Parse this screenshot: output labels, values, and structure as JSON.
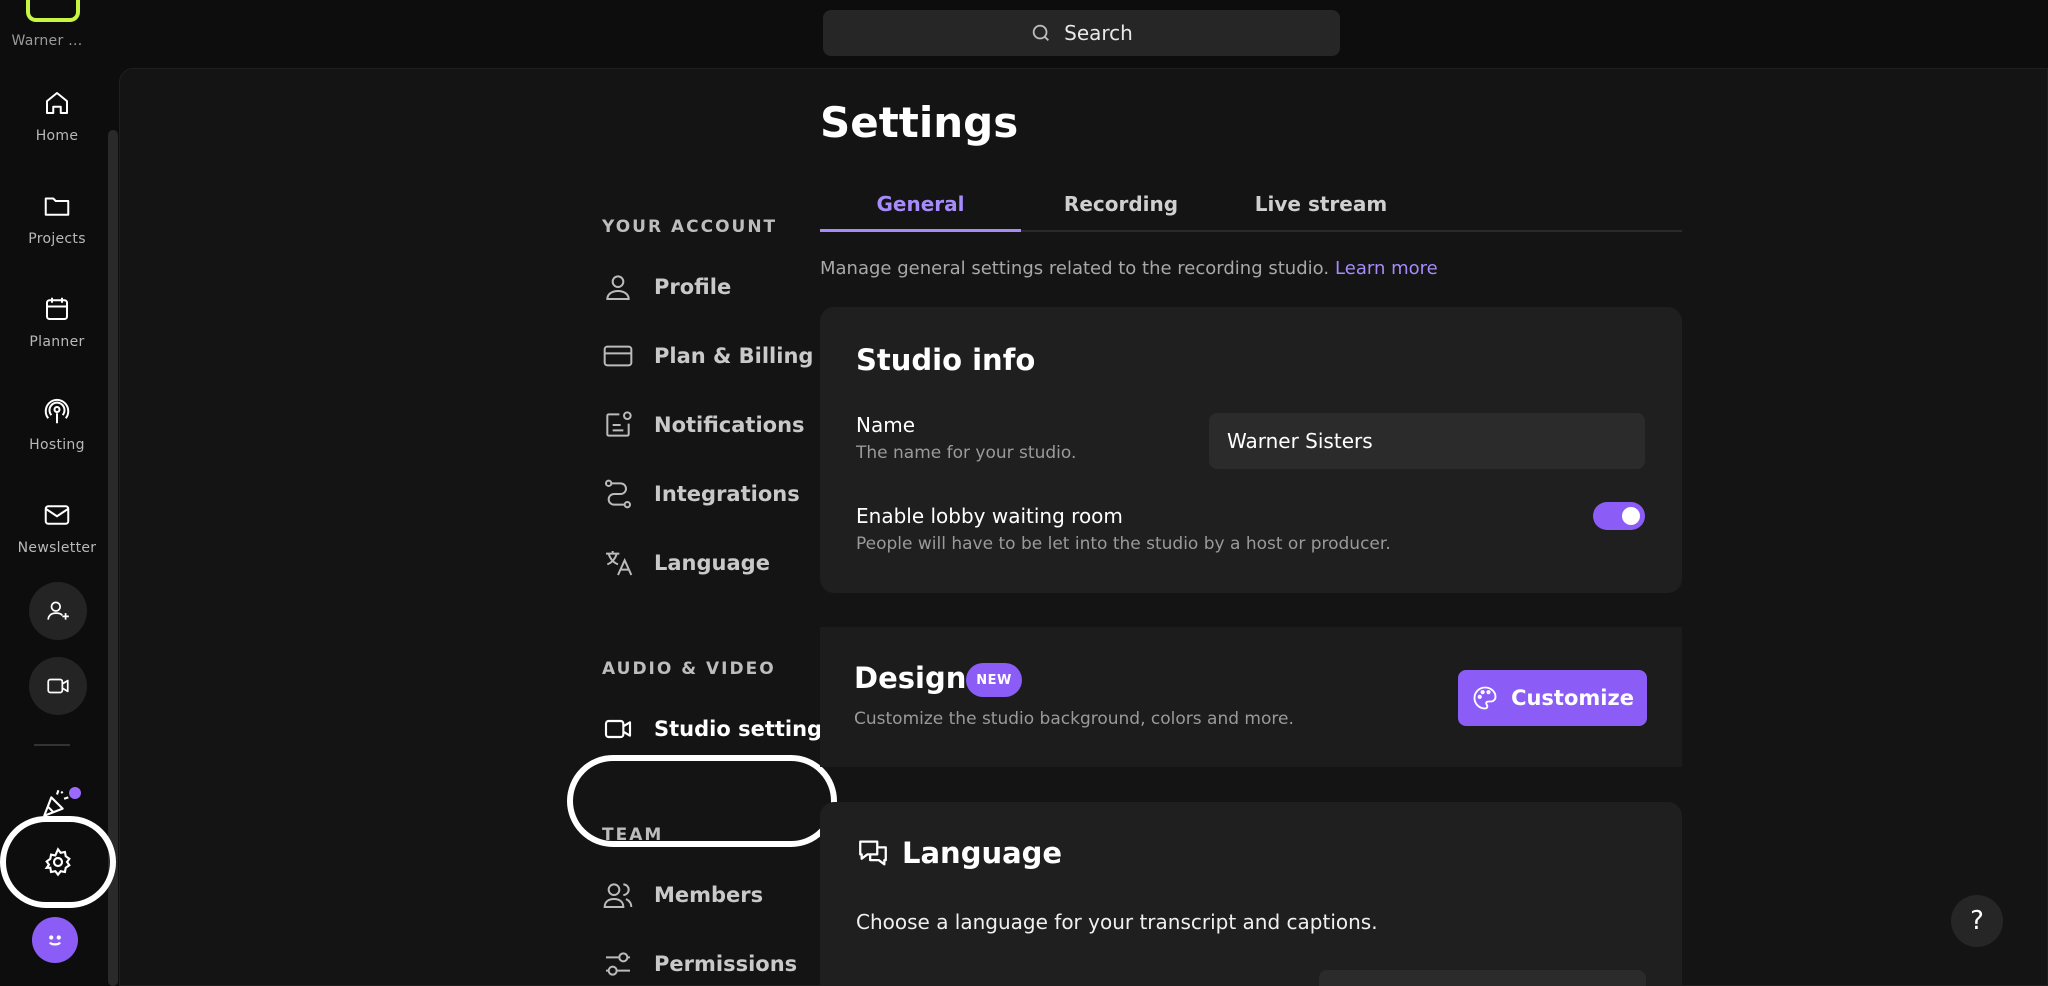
{
  "workspace": {
    "name": "Warner ..."
  },
  "rail": {
    "items": [
      {
        "label": "Home",
        "icon": "home-icon"
      },
      {
        "label": "Projects",
        "icon": "folder-icon"
      },
      {
        "label": "Planner",
        "icon": "calendar-icon"
      },
      {
        "label": "Hosting",
        "icon": "podcast-icon"
      },
      {
        "label": "Newsletter",
        "icon": "mail-icon"
      }
    ]
  },
  "search": {
    "label": "Search"
  },
  "settings_nav": {
    "your_account_heading": "YOUR ACCOUNT",
    "your_account": [
      {
        "label": "Profile",
        "icon": "user-icon"
      },
      {
        "label": "Plan & Billing",
        "icon": "credit-card-icon"
      },
      {
        "label": "Notifications",
        "icon": "notification-icon"
      },
      {
        "label": "Integrations",
        "icon": "integrations-icon"
      },
      {
        "label": "Language",
        "icon": "translate-icon"
      }
    ],
    "audio_video_heading": "AUDIO & VIDEO",
    "studio_settings": "Studio settings",
    "team_heading": "TEAM",
    "team": [
      {
        "label": "Members",
        "icon": "users-icon"
      },
      {
        "label": "Permissions",
        "icon": "sliders-icon"
      }
    ]
  },
  "main": {
    "title": "Settings",
    "tabs": [
      {
        "label": "General",
        "active": true
      },
      {
        "label": "Recording",
        "active": false
      },
      {
        "label": "Live stream",
        "active": false
      }
    ],
    "description": "Manage general settings related to the recording studio.",
    "learn_more": "Learn more"
  },
  "studio_info": {
    "title": "Studio info",
    "name_label": "Name",
    "name_help": "The name for your studio.",
    "name_value": "Warner Sisters",
    "lobby_label": "Enable lobby waiting room",
    "lobby_help": "People will have to be let into the studio by a host or producer.",
    "lobby_enabled": true
  },
  "design": {
    "title": "Design",
    "badge": "NEW",
    "help": "Customize the studio background, colors and more.",
    "button": "Customize"
  },
  "language": {
    "title": "Language",
    "description": "Choose a language for your transcript and captions."
  },
  "help": {
    "label": "?"
  },
  "colors": {
    "accent": "#8b5cf6",
    "accent_text": "#a78bfa",
    "background": "#0d0d0d",
    "panel": "#141414",
    "card": "#1f1f1f"
  }
}
